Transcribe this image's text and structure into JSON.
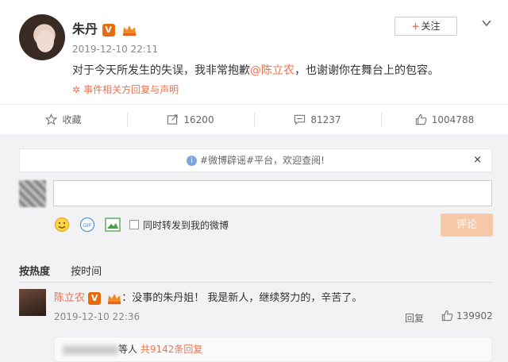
{
  "post": {
    "username": "朱丹",
    "verified_badge": "V",
    "time": "2019-12-10 22:11",
    "text_before": "对于今天所发生的失误，我非常抱歉",
    "mention": "@陈立农",
    "text_after": "，也谢谢你在舞台上的包容。",
    "tag": "事件相关方回复与声明",
    "follow_label": "关注",
    "follow_plus": "+"
  },
  "actions": {
    "favorite": "收藏",
    "repost": "16200",
    "comment": "81237",
    "like": "1004788"
  },
  "notice": {
    "text": "#微博辟谣#平台，欢迎查阅!",
    "info": "i",
    "close": "×"
  },
  "composer": {
    "input_value": "",
    "repost_label": "同时转发到我的微博",
    "submit_label": "评论"
  },
  "sort": {
    "hot": "按热度",
    "time": "按时间"
  },
  "comment": {
    "username": "陈立农",
    "verified_badge": "V",
    "text": "：没事的朱丹姐！ 我是新人，继续努力的，辛苦了。",
    "time": "2019-12-10 22:36",
    "reply_label": "回复",
    "likes": "139902",
    "sub_suffix": "等人",
    "sub_count": "共9142条回复"
  },
  "colors": {
    "accent": "#eb7350",
    "badge": "#e86b0e",
    "submit_disabled": "#f7c8a7"
  }
}
